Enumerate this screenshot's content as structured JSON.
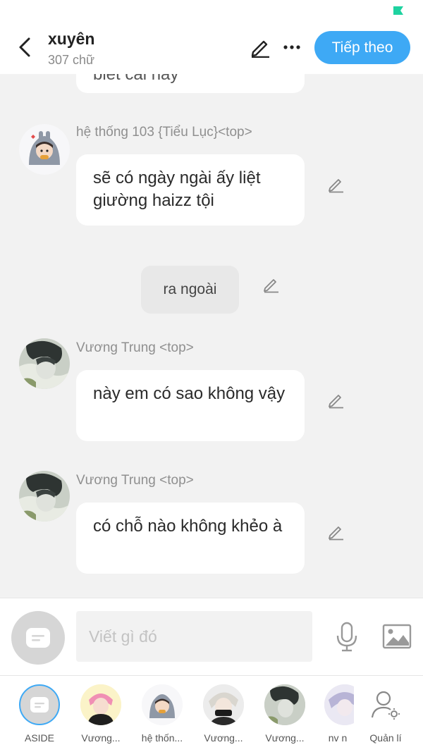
{
  "header": {
    "title": "xuyên",
    "subtitle": "307 chữ",
    "next_button": "Tiếp theo"
  },
  "messages": [
    {
      "type": "clipped",
      "text": "biết cái này"
    },
    {
      "type": "message",
      "sender": "hệ thống 103 {Tiểu Lục}<top>",
      "text": "sẽ có ngày ngài ấy liệt giường haizz tội"
    },
    {
      "type": "narration",
      "text": "ra ngoài"
    },
    {
      "type": "message",
      "sender": "Vương Trung <top>",
      "text": "này em có sao không vậy"
    },
    {
      "type": "message",
      "sender": "Vương Trung <top>",
      "text": "có chỗ nào không khẻo à"
    }
  ],
  "input": {
    "placeholder": "Viết gì đó"
  },
  "characters": [
    {
      "label": "ASIDE"
    },
    {
      "label": "Vương..."
    },
    {
      "label": "hệ thốn..."
    },
    {
      "label": "Vương..."
    },
    {
      "label": "Vương..."
    },
    {
      "label": "nv n"
    },
    {
      "label": "Quản lí"
    }
  ],
  "colors": {
    "accent": "#3ea9f5",
    "status": "#1ed2a0"
  }
}
